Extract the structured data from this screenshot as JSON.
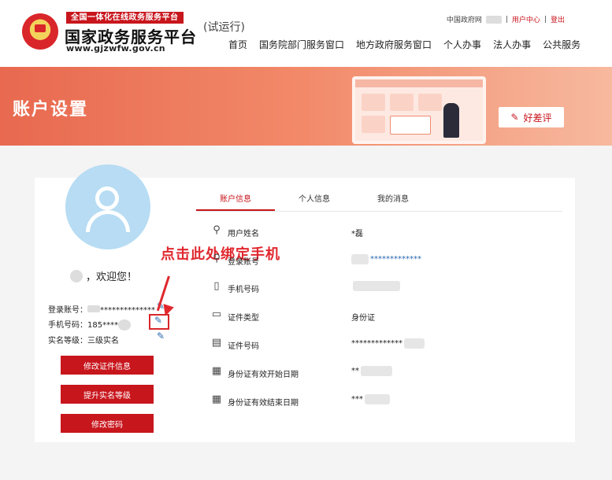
{
  "header": {
    "badge": "全国一体化在线政务服务平台",
    "site_name": "国家政务服务平台",
    "site_url": "www.gjzwfw.gov.cn",
    "trial": "(试运行)",
    "top_links": {
      "gov": "中国政府网",
      "user_center": "用户中心",
      "logout": "登出"
    },
    "nav": [
      "首页",
      "国务院部门服务窗口",
      "地方政府服务窗口",
      "个人办事",
      "法人办事",
      "公共服务"
    ]
  },
  "banner": {
    "title": "账户设置",
    "review_button": "好差评"
  },
  "profile": {
    "welcome": "，欢迎您！",
    "login_label": "登录账号：",
    "login_value": "**************",
    "phone_label": "手机号码：",
    "phone_value": "185****",
    "level_label": "实名等级：",
    "level_value": "三级实名",
    "buttons": [
      "修改证件信息",
      "提升实名等级",
      "修改密码"
    ]
  },
  "annotation": "点击此处绑定手机",
  "tabs": [
    "账户信息",
    "个人信息",
    "我的消息"
  ],
  "rows": [
    {
      "icon": "user-icon",
      "label": "用户姓名",
      "value": "*磊"
    },
    {
      "icon": "account-icon",
      "label": "登录账号",
      "value": "*************"
    },
    {
      "icon": "phone-icon",
      "label": "手机号码",
      "value": ""
    },
    {
      "icon": "id-card-icon",
      "label": "证件类型",
      "value": "身份证"
    },
    {
      "icon": "id-number-icon",
      "label": "证件号码",
      "value": "*************"
    },
    {
      "icon": "calendar-start-icon",
      "label": "身份证有效开始日期",
      "value": "**"
    },
    {
      "icon": "calendar-end-icon",
      "label": "身份证有效结束日期",
      "value": "***"
    }
  ],
  "colors": {
    "brand_red": "#c8161d",
    "banner": "#ec7457",
    "link_blue": "#2a6ab2"
  }
}
